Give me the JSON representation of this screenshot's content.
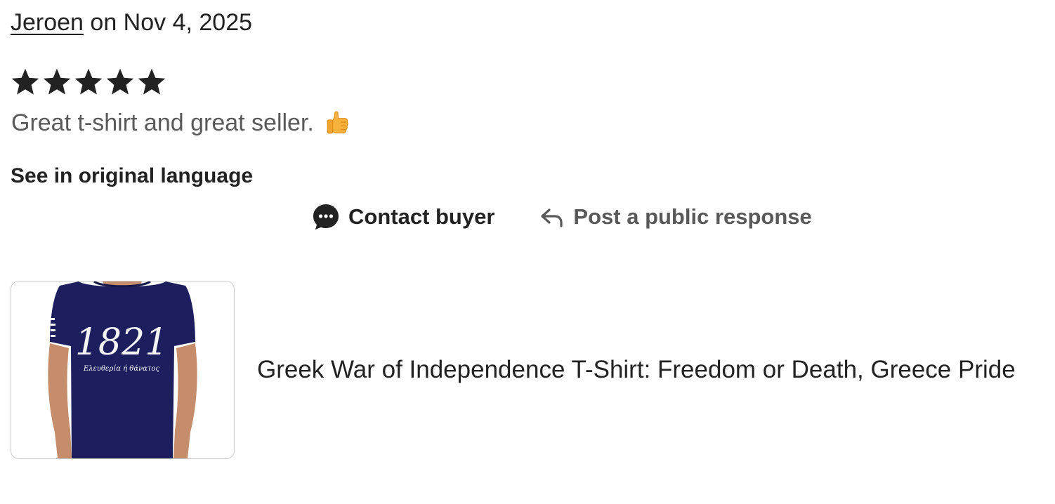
{
  "review": {
    "reviewer_name": "Jeroen",
    "date_text": " on Nov 4, 2025",
    "rating": 5,
    "rating_max": 5,
    "text": "Great t-shirt and great seller.",
    "emoji_icon": "thumbs-up-icon",
    "see_original_label": "See in original language"
  },
  "actions": {
    "contact_label": "Contact buyer",
    "contact_icon": "chat-bubble-icon",
    "response_label": "Post a public response",
    "response_icon": "reply-arrow-icon"
  },
  "listing": {
    "title": "Greek War of Independence T-Shirt: Freedom or Death, Greece Pride",
    "shirt_print_year": "1821",
    "shirt_print_motto": "Ελευθερία ή θάνατος",
    "shirt_color": "#1c1e5e"
  },
  "colors": {
    "text_primary": "#222222",
    "text_secondary": "#595959",
    "star": "#222222"
  }
}
